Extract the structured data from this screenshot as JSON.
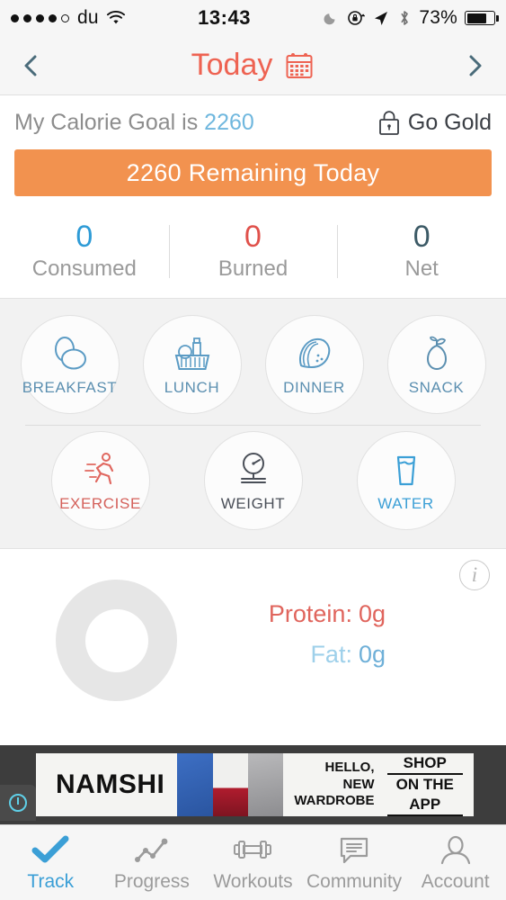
{
  "status_bar": {
    "signal_dots": 5,
    "signal_filled": 4,
    "carrier": "du",
    "wifi_icon": "wifi-icon",
    "time": "13:43",
    "dnd_icon": "moon-icon",
    "rotation_lock_icon": "rotation-lock-icon",
    "location_icon": "location-arrow-icon",
    "bluetooth_icon": "bluetooth-icon",
    "battery_percent": "73%",
    "battery_level": 73
  },
  "navbar": {
    "prev_icon": "chevron-left-icon",
    "title": "Today",
    "calendar_icon": "calendar-icon",
    "next_icon": "chevron-right-icon",
    "title_color": "#ee6352"
  },
  "goal": {
    "label_prefix": "My Calorie Goal is ",
    "value": "2260",
    "lock_icon": "lock-icon",
    "go_gold_label": "Go Gold",
    "banner_text": "2260 Remaining Today",
    "banner_color": "#f2924f",
    "value_color": "#6fb7de"
  },
  "stats": [
    {
      "value": "0",
      "label": "Consumed",
      "color": "#2e9bd6"
    },
    {
      "value": "0",
      "label": "Burned",
      "color": "#e0514b"
    },
    {
      "value": "0",
      "label": "Net",
      "color": "#3c5a66"
    }
  ],
  "meals": [
    {
      "label": "BREAKFAST",
      "icon": "eggs-icon",
      "color": "#5b9bc4"
    },
    {
      "label": "LUNCH",
      "icon": "grocery-basket-icon",
      "color": "#5b9bc4"
    },
    {
      "label": "DINNER",
      "icon": "taco-icon",
      "color": "#5b9bc4"
    },
    {
      "label": "SNACK",
      "icon": "pear-icon",
      "color": "#5b8fb0"
    }
  ],
  "activities": [
    {
      "label": "EXERCISE",
      "icon": "running-person-icon",
      "color": "#e0675f"
    },
    {
      "label": "WEIGHT",
      "icon": "weight-scale-icon",
      "color": "#4a4f58"
    },
    {
      "label": "WATER",
      "icon": "water-glass-icon",
      "color": "#3b9fd6"
    }
  ],
  "macros": {
    "info_icon": "info-icon",
    "chart_icon": "donut-chart-icon",
    "items": [
      {
        "label": "Protein:",
        "value": "0g",
        "color": "#e0655d"
      },
      {
        "label": "Fat:",
        "value": "0g",
        "color": "#8cc6e8"
      }
    ]
  },
  "chart_data": {
    "type": "pie",
    "title": "",
    "categories": [
      "Protein",
      "Fat"
    ],
    "values": [
      0,
      0
    ],
    "units": "g",
    "empty": true,
    "legend_position": "right",
    "colors": [
      "#e0655d",
      "#8cc6e8"
    ]
  },
  "ad": {
    "brand": "NAMSHI",
    "headline_line1": "HELLO,",
    "headline_line2": "NEW",
    "headline_line3": "WARDROBE",
    "cta_line1": "SHOP",
    "cta_line2": "ON THE APP",
    "info_badge_icon": "ad-info-icon"
  },
  "tabbar": [
    {
      "label": "Track",
      "icon": "checkmark-icon",
      "active": true
    },
    {
      "label": "Progress",
      "icon": "line-chart-icon",
      "active": false
    },
    {
      "label": "Workouts",
      "icon": "dumbbell-icon",
      "active": false
    },
    {
      "label": "Community",
      "icon": "speech-bubble-icon",
      "active": false
    },
    {
      "label": "Account",
      "icon": "person-icon",
      "active": false
    }
  ]
}
